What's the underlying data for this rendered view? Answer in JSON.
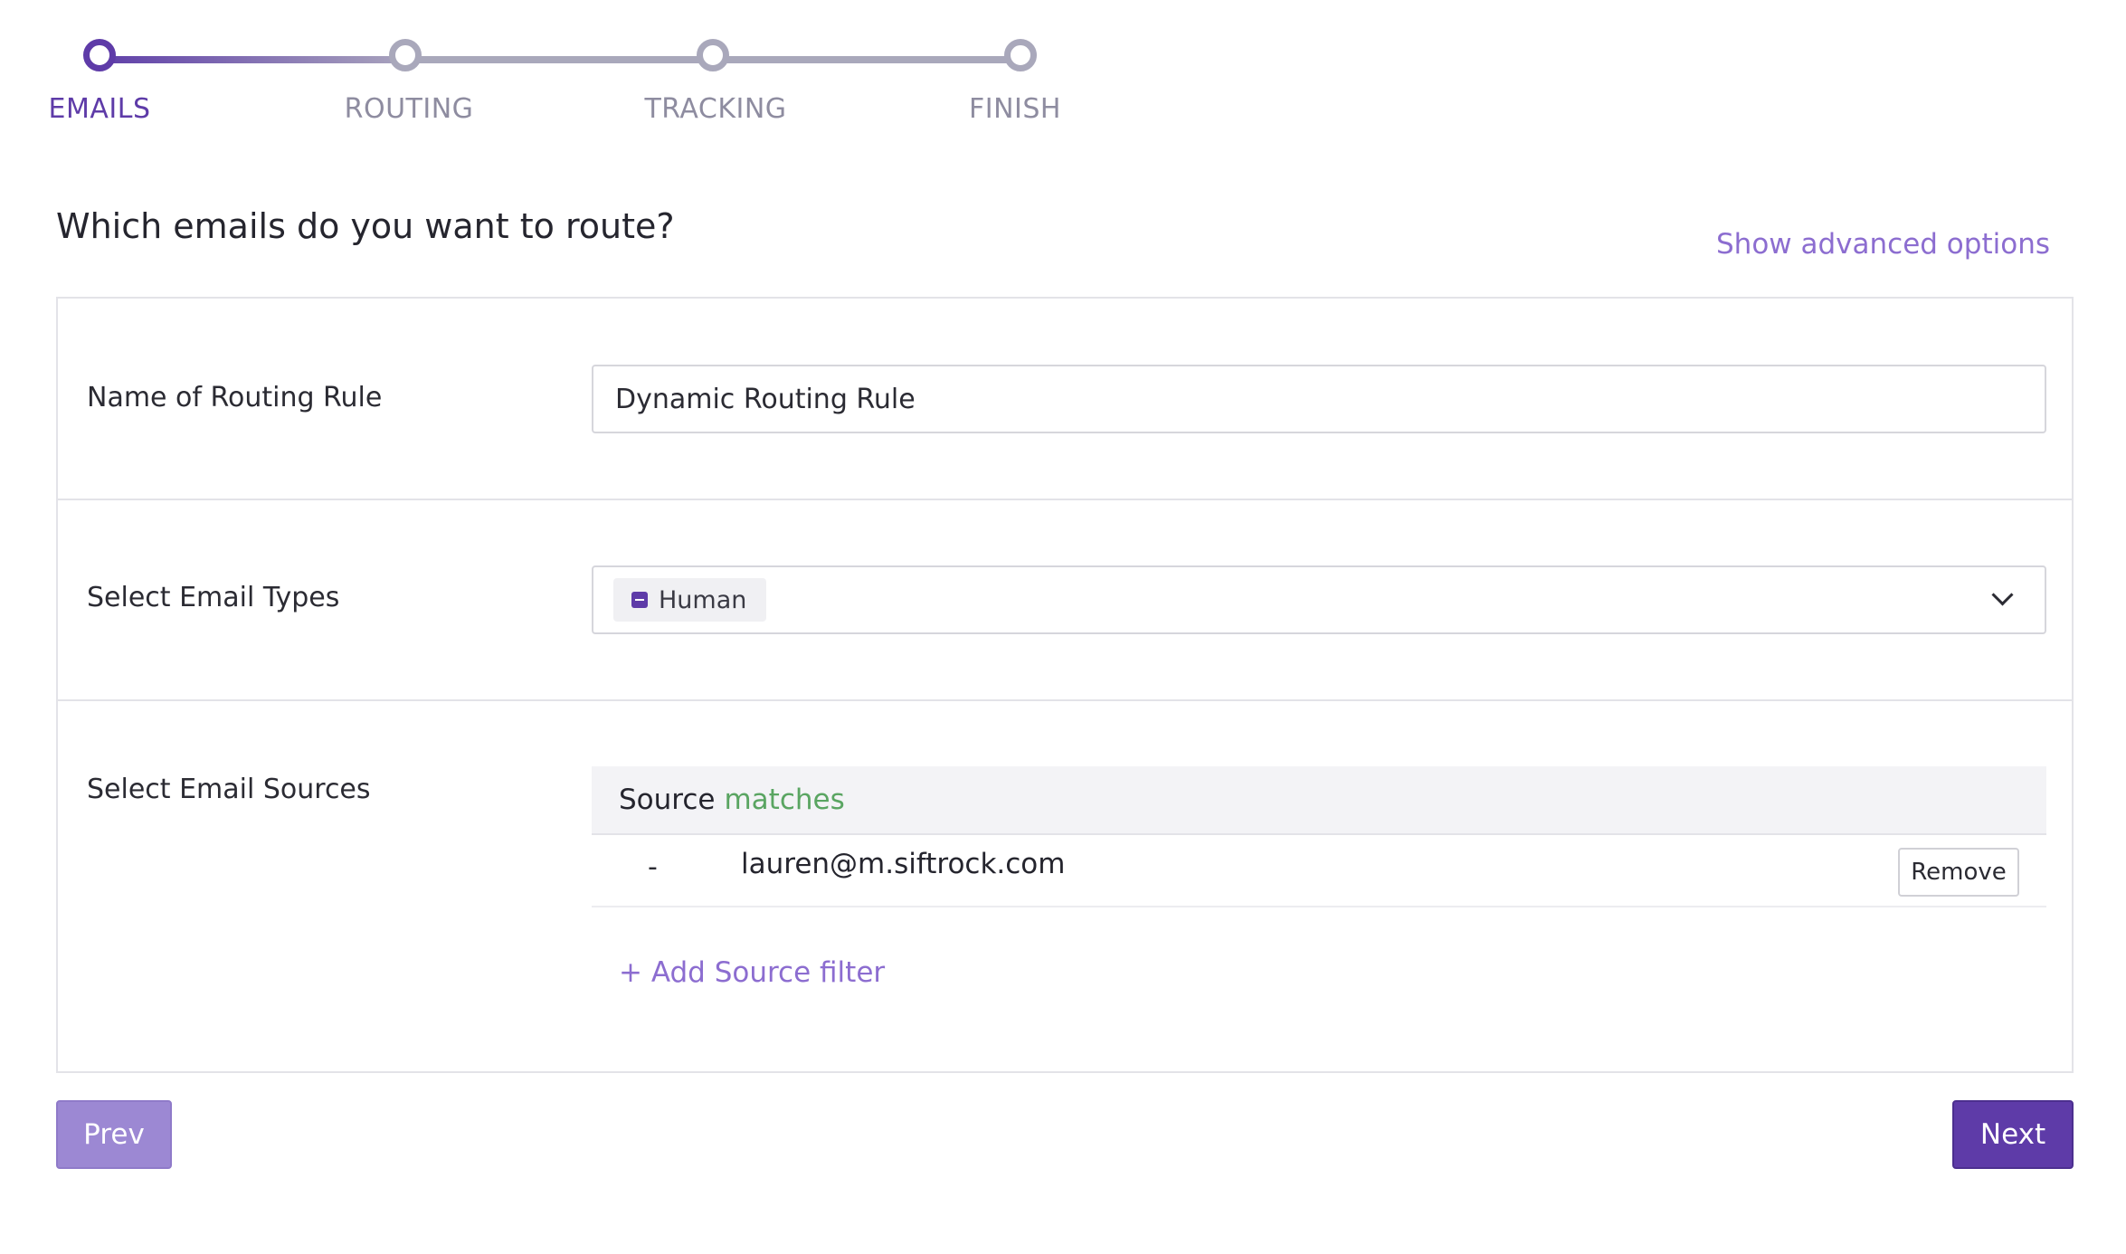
{
  "stepper": {
    "steps": [
      {
        "label": "EMAILS",
        "state": "active"
      },
      {
        "label": "ROUTING",
        "state": "pending"
      },
      {
        "label": "TRACKING",
        "state": "pending"
      },
      {
        "label": "FINISH",
        "state": "pending"
      }
    ]
  },
  "header": {
    "title": "Which emails do you want to route?",
    "advanced_link": "Show advanced options"
  },
  "form": {
    "rule_name": {
      "label": "Name of Routing Rule",
      "value": "Dynamic Routing Rule"
    },
    "email_types": {
      "label": "Select Email Types",
      "selected": [
        "Human"
      ]
    },
    "email_sources": {
      "label": "Select Email Sources",
      "header_field": "Source",
      "header_operator": "matches",
      "rows": [
        {
          "marker": "-",
          "value": "lauren@m.siftrock.com",
          "remove_label": "Remove"
        }
      ],
      "add_filter_label": "+ Add Source filter"
    }
  },
  "footer": {
    "prev_label": "Prev",
    "next_label": "Next"
  },
  "colors": {
    "accent": "#5e3ba8",
    "link": "#8c6dd0",
    "prev_button": "#9c88d3",
    "match_operator": "#5aa562",
    "inactive_step": "#a9a8bb"
  }
}
